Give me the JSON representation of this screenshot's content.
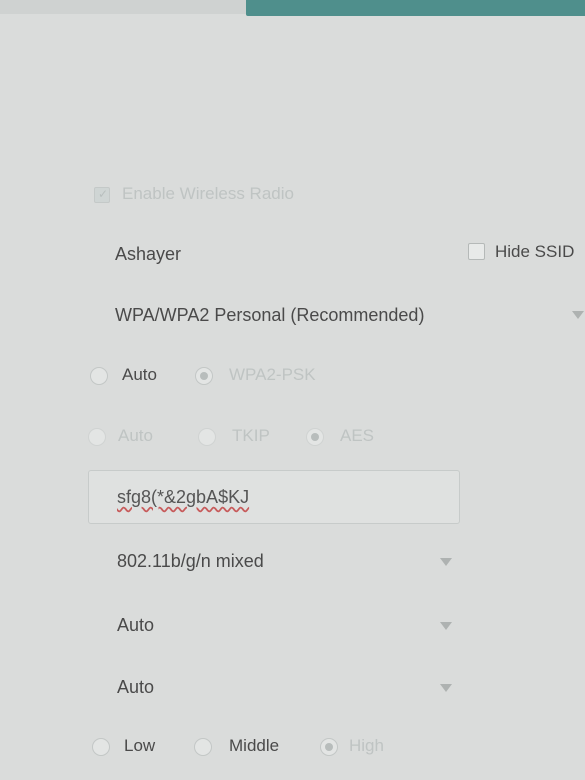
{
  "wireless": {
    "enable_radio_label": "Enable Wireless Radio",
    "enable_radio_checked": true,
    "ssid": "Ashayer",
    "hide_ssid_label": "Hide SSID",
    "hide_ssid_checked": false,
    "security": "WPA/WPA2 Personal (Recommended)",
    "version": {
      "options": [
        "Auto",
        "WPA2-PSK"
      ],
      "selected": "WPA2-PSK"
    },
    "encryption": {
      "options": [
        "Auto",
        "TKIP",
        "AES"
      ],
      "selected": "AES"
    },
    "password": "sfg8(*&2gbA$KJ",
    "mode": "802.11b/g/n mixed",
    "channel": "Auto",
    "channel_width": "Auto",
    "transmit_power": {
      "options": [
        "Low",
        "Middle",
        "High"
      ],
      "selected": "High"
    }
  },
  "icons": {
    "checkbox": "checkbox-icon",
    "radio": "radio-icon",
    "dropdown": "chevron-down-icon"
  },
  "colors": {
    "accent_bar": "#4f8f8c",
    "background": "#dadcdb"
  }
}
